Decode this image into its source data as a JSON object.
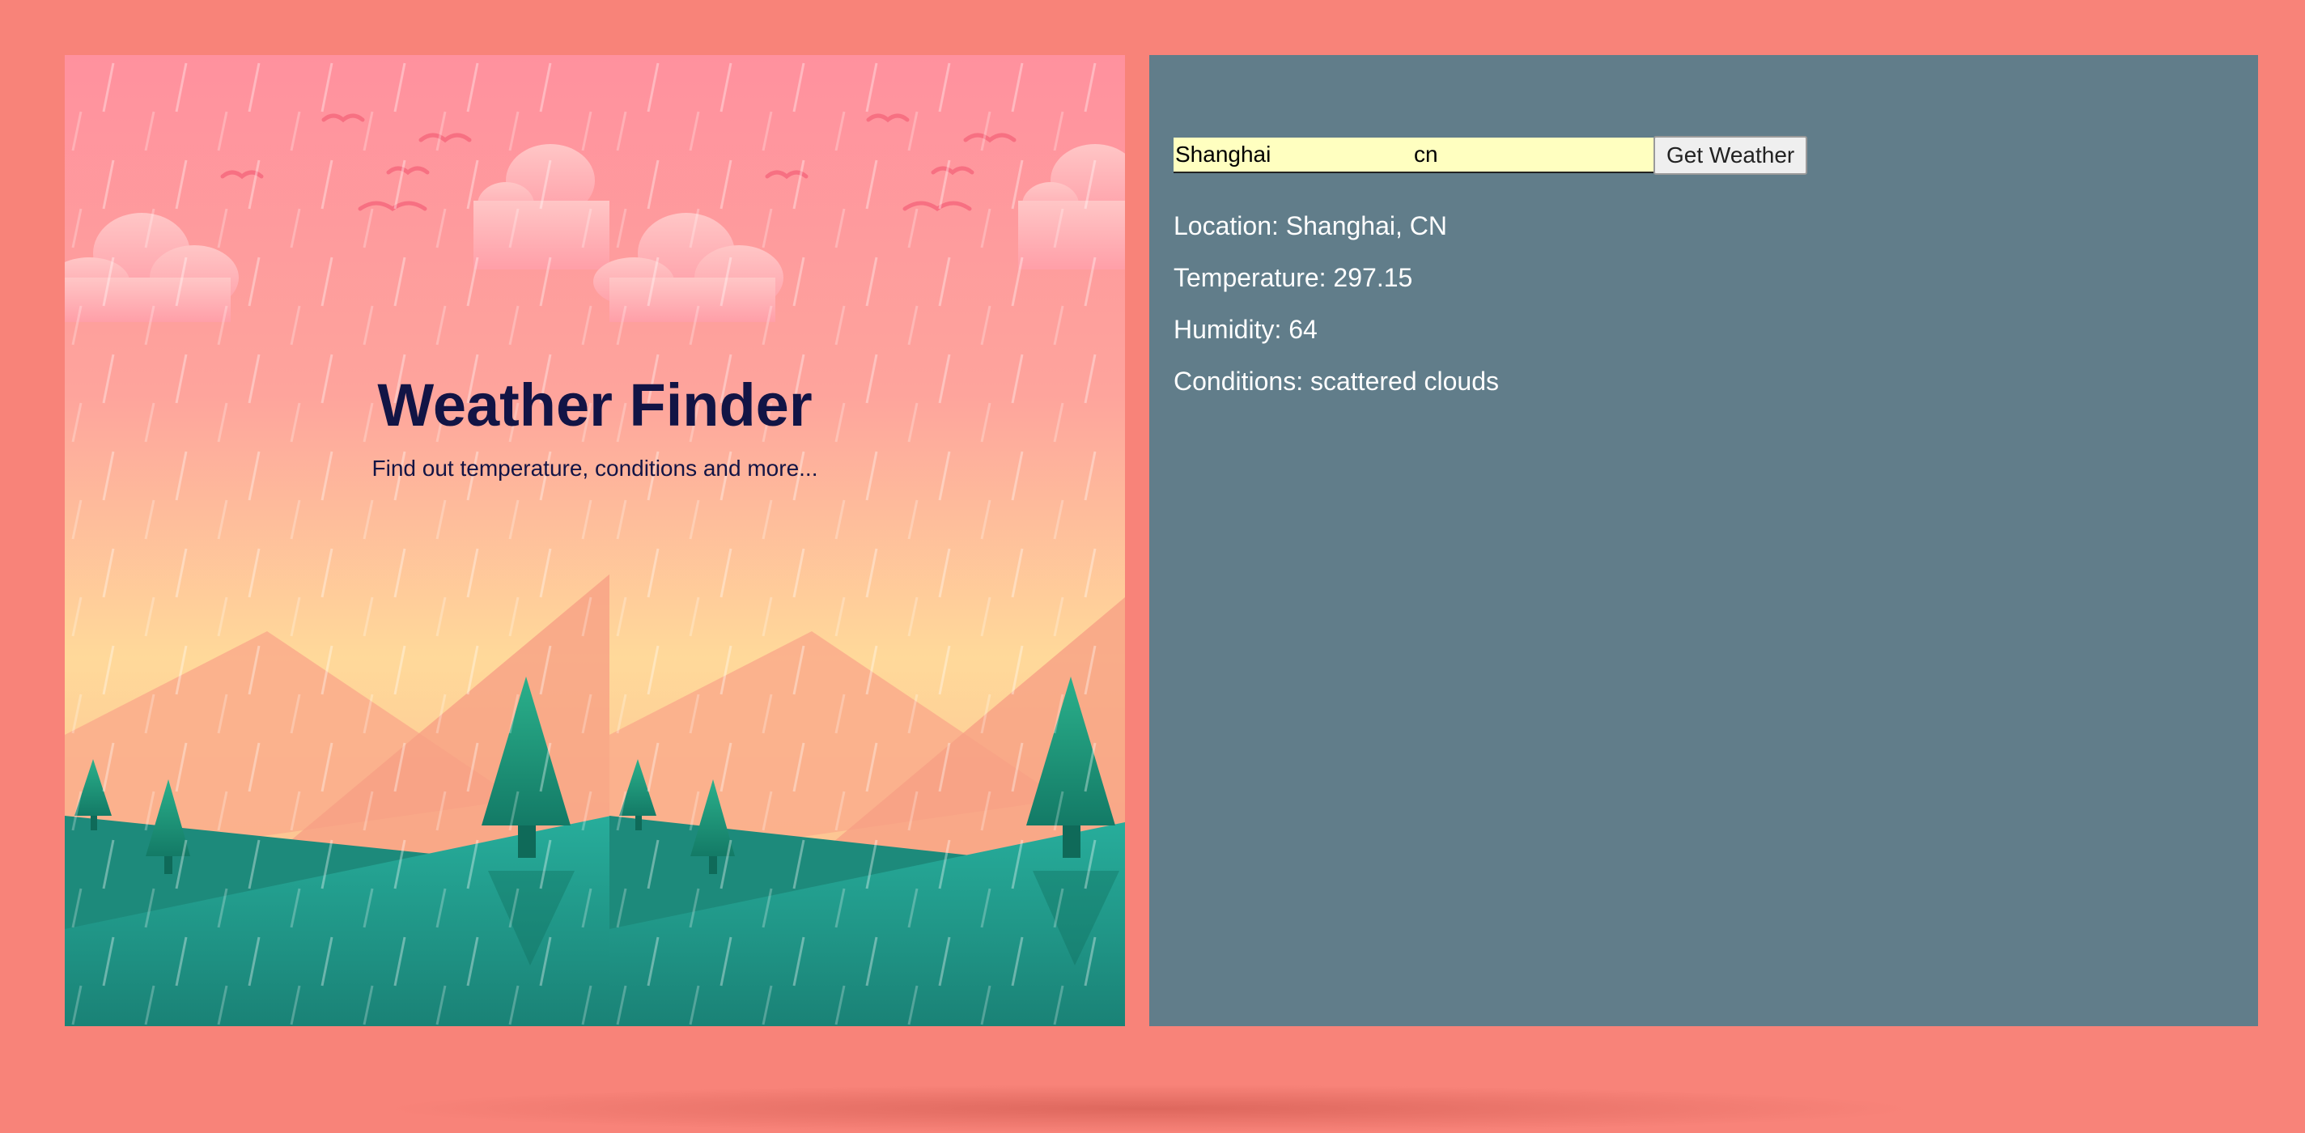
{
  "hero": {
    "title": "Weather Finder",
    "subtitle": "Find out temperature, conditions and more..."
  },
  "form": {
    "city_value": "Shanghai",
    "country_value": "cn",
    "submit_label": "Get Weather"
  },
  "results": {
    "location_label": "Location:",
    "location_value": "Shanghai, CN",
    "temperature_label": "Temperature:",
    "temperature_value": "297.15",
    "humidity_label": "Humidity:",
    "humidity_value": "64",
    "conditions_label": "Conditions:",
    "conditions_value": "scattered clouds"
  },
  "colors": {
    "page_background": "#f88379",
    "results_panel": "#617d8a",
    "title_text": "#121445",
    "input_background": "#ffffc0",
    "sky_top": "#ff919e",
    "sky_horizon": "#ffd99a",
    "ground": "#24a596"
  },
  "icons": {
    "scene": "rainy-landscape-illustration",
    "clouds": "cloud-icon",
    "birds": "bird-icon",
    "trees": "pine-tree-icon"
  }
}
